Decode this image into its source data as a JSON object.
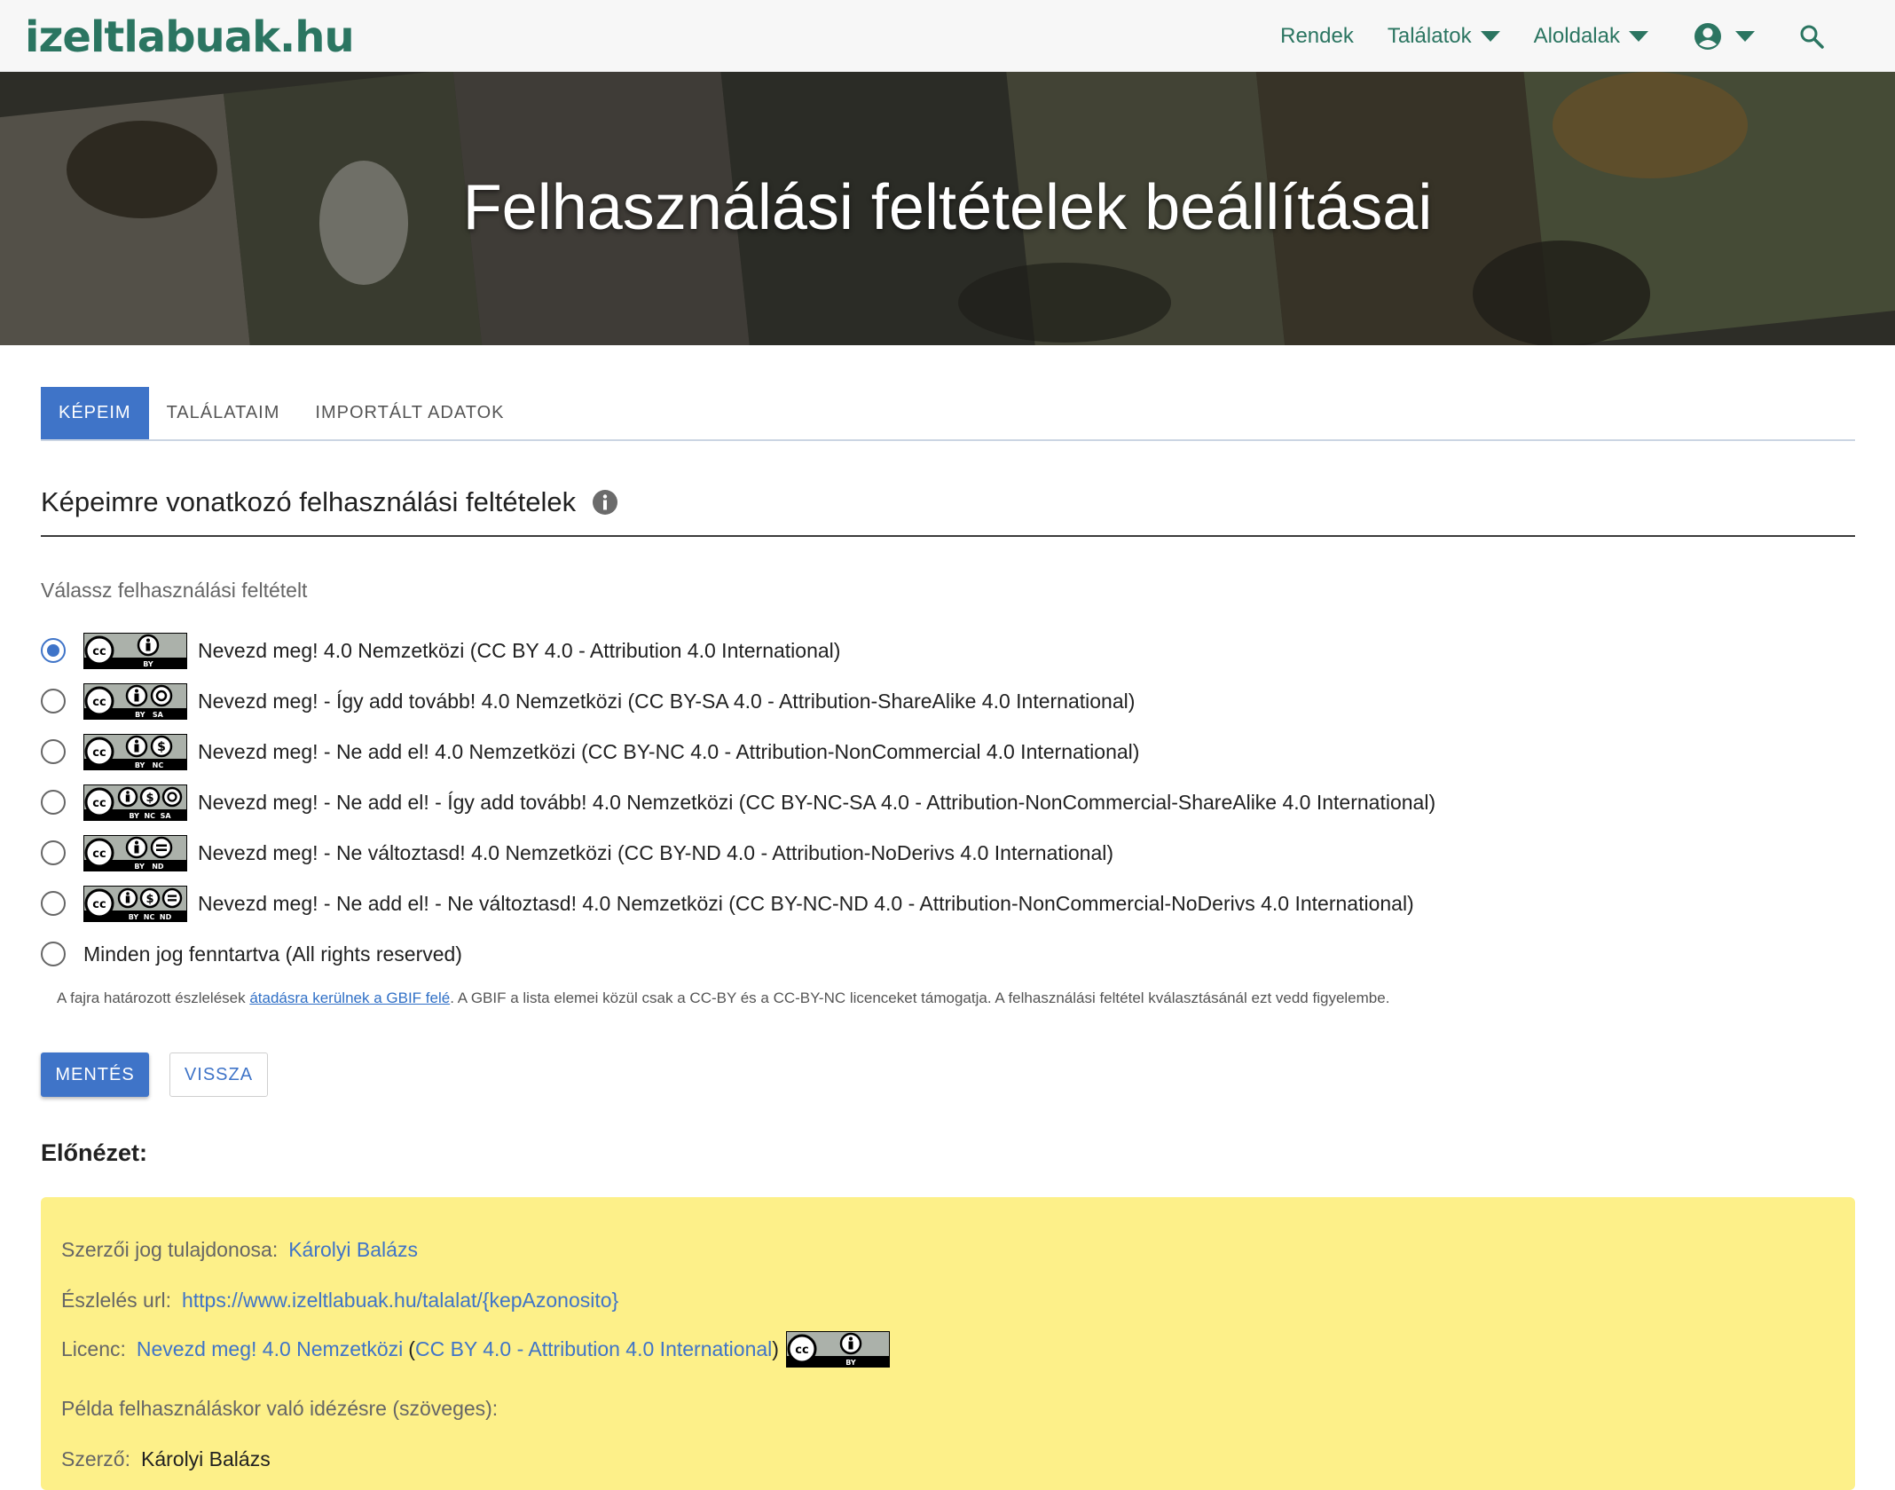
{
  "navbar": {
    "logo": "izeltlabuak.hu",
    "items": [
      {
        "label": "Rendek",
        "has_caret": false
      },
      {
        "label": "Találatok",
        "has_caret": true
      },
      {
        "label": "Aloldalak",
        "has_caret": true
      }
    ],
    "icons": [
      "user-circle-icon",
      "caret-down-icon",
      "search-icon"
    ],
    "accent_color": "#2b7561"
  },
  "hero": {
    "title": "Felhasználási feltételek beállításai"
  },
  "tabs": [
    {
      "label": "KÉPEIM",
      "active": true
    },
    {
      "label": "TALÁLATAIM",
      "active": false
    },
    {
      "label": "IMPORTÁLT ADATOK",
      "active": false
    }
  ],
  "section": {
    "title": "Képeimre vonatkozó felhasználási feltételek",
    "choose_label": "Válassz felhasználási feltételt"
  },
  "license_options": [
    {
      "label": "Nevezd meg! 4.0 Nemzetközi (CC BY 4.0 - Attribution 4.0 International)",
      "checked": true,
      "badge_icons": [
        "by"
      ],
      "badge_text": "BY"
    },
    {
      "label": "Nevezd meg! - Így add tovább! 4.0 Nemzetközi (CC BY-SA 4.0 - Attribution-ShareAlike 4.0 International)",
      "checked": false,
      "badge_icons": [
        "by",
        "sa"
      ],
      "badge_text": "BY   SA"
    },
    {
      "label": "Nevezd meg! - Ne add el! 4.0 Nemzetközi (CC BY-NC 4.0 - Attribution-NonCommercial 4.0 International)",
      "checked": false,
      "badge_icons": [
        "by",
        "nc"
      ],
      "badge_text": "BY   NC"
    },
    {
      "label": "Nevezd meg! - Ne add el! - Így add tovább! 4.0 Nemzetközi (CC BY-NC-SA 4.0 - Attribution-NonCommercial-ShareAlike 4.0 International)",
      "checked": false,
      "badge_icons": [
        "by",
        "nc",
        "sa"
      ],
      "badge_text": "BY  NC  SA"
    },
    {
      "label": "Nevezd meg! - Ne változtasd! 4.0 Nemzetközi (CC BY-ND 4.0 - Attribution-NoDerivs 4.0 International)",
      "checked": false,
      "badge_icons": [
        "by",
        "nd"
      ],
      "badge_text": "BY   ND"
    },
    {
      "label": "Nevezd meg! - Ne add el! - Ne változtasd! 4.0 Nemzetközi (CC BY-NC-ND 4.0 - Attribution-NonCommercial-NoDerivs 4.0 International)",
      "checked": false,
      "badge_icons": [
        "by",
        "nc",
        "nd"
      ],
      "badge_text": "BY  NC  ND"
    },
    {
      "label": "Minden jog fenntartva (All rights reserved)",
      "checked": false,
      "badge_icons": [],
      "badge_text": ""
    }
  ],
  "note": {
    "before": "A fajra határozott észlelések ",
    "link": "átadásra kerülnek a GBIF felé",
    "after": ". A GBIF a lista elemei közül csak a CC-BY és a CC-BY-NC licenceket támogatja. A felhasználási feltétel kválasztásánál ezt vedd figyelembe."
  },
  "buttons": {
    "save": "MENTÉS",
    "back": "VISSZA"
  },
  "preview": {
    "title": "Előnézet:",
    "copyright_label": "Szerzői jog tulajdonosa:",
    "copyright_value": "Károlyi Balázs",
    "url_label": "Észlelés url:",
    "url_value": "https://www.izeltlabuak.hu/talalat/{kepAzonosito}",
    "license_label": "Licenc:",
    "license_name": "Nevezd meg! 4.0 Nemzetközi",
    "license_paren_open": "(",
    "license_code": "CC BY 4.0 - Attribution 4.0 International",
    "license_paren_close": ")",
    "example_label": "Példa felhasználáskor való idézésre (szöveges):",
    "author_label": "Szerző:",
    "author_value": "Károlyi Balázs"
  },
  "colors": {
    "primary": "#3f74c8",
    "preview_bg": "#fdf089"
  }
}
